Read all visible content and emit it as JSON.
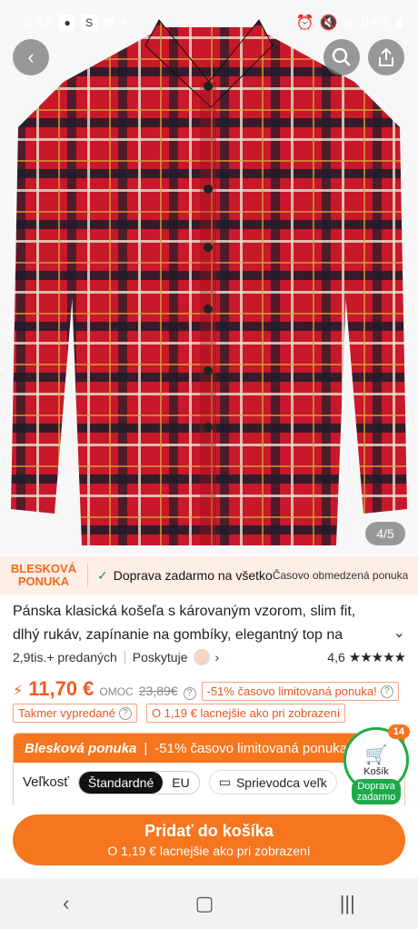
{
  "status": {
    "time": "9:49",
    "battery": "84%"
  },
  "gallery": {
    "counter": "4/5"
  },
  "flash_banner": {
    "badge_line1": "BLESKOVÁ",
    "badge_line2": "PONUKA",
    "shipping": "Doprava zadarmo na všetko",
    "limited": "Časovo obmedzená ponuka"
  },
  "product": {
    "title": "Pánska klasická košeľa s károvaným vzorom, slim fit, dlhý rukáv, zapínanie na gombíky, elegantný top na obcho",
    "sold": "2,9tis.+ predaných",
    "provider": "Poskytuje",
    "rating": "4,6",
    "stars": "★★★★★"
  },
  "price": {
    "current": "11,70 €",
    "omoc_label": "OMOC",
    "old": "23,89€",
    "discount_tag": "-51% časovo limitovaná ponuka!"
  },
  "tags": {
    "almost_sold": "Takmer vypredané",
    "cheaper": "O 1,19 € lacnejšie ako pri zobrazení"
  },
  "panel": {
    "title": "Blesková ponuka",
    "sub": "-51% časovo limitovaná ponuka!",
    "size_label": "Veľkosť",
    "size_options": [
      "Štandardné",
      "EU"
    ],
    "guide": "Sprievodca veľk"
  },
  "cart": {
    "count": "14",
    "label": "Košík",
    "pill_line1": "Doprava",
    "pill_line2": "zadarmo"
  },
  "add_to_cart": {
    "main": "Pridať do košíka",
    "sub": "O 1,19 € lacnejšie ako pri zobrazení"
  },
  "colors": {
    "accent": "#f5761f",
    "price": "#f15a24",
    "green": "#1faa4a"
  }
}
